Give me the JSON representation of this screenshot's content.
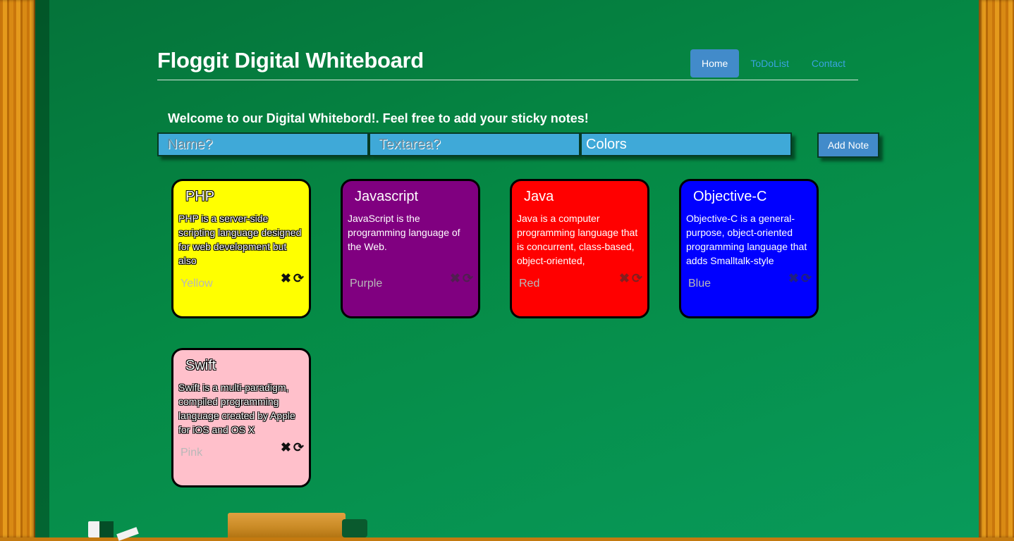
{
  "header": {
    "title": "Floggit Digital Whiteboard",
    "nav": [
      {
        "label": "Home",
        "active": true
      },
      {
        "label": "ToDoList",
        "active": false
      },
      {
        "label": "Contact",
        "active": false
      }
    ]
  },
  "form": {
    "welcome": "Welcome to our Digital Whitebord!. Feel free to add your sticky notes!",
    "name_placeholder": "Name?",
    "text_placeholder": "Textarea?",
    "colors_value": "Colors",
    "add_button": "Add Note"
  },
  "notes": [
    {
      "title": "PHP",
      "text": "PHP is a server-side scripting language designed for web development but also",
      "color": "Yellow",
      "bg": "#ffff00"
    },
    {
      "title": "Javascript",
      "text": "JavaScript is the programming language of the Web.",
      "color": "Purple",
      "bg": "#800080"
    },
    {
      "title": "Java",
      "text": "Java is a computer programming language that is concurrent, class-based, object-oriented,",
      "color": "Red",
      "bg": "#ff0000"
    },
    {
      "title": "Objective-C",
      "text": "Objective-C is a general-purpose, object-oriented programming language that adds Smalltalk-style",
      "color": "Blue",
      "bg": "#0000ff"
    },
    {
      "title": "Swift",
      "text": "Swift is a multi-paradigm, compiled programming language created by Apple for iOS and OS X",
      "color": "Pink",
      "bg": "#ffc0cb"
    }
  ],
  "icons": {
    "delete": "close-icon",
    "refresh": "refresh-icon"
  }
}
